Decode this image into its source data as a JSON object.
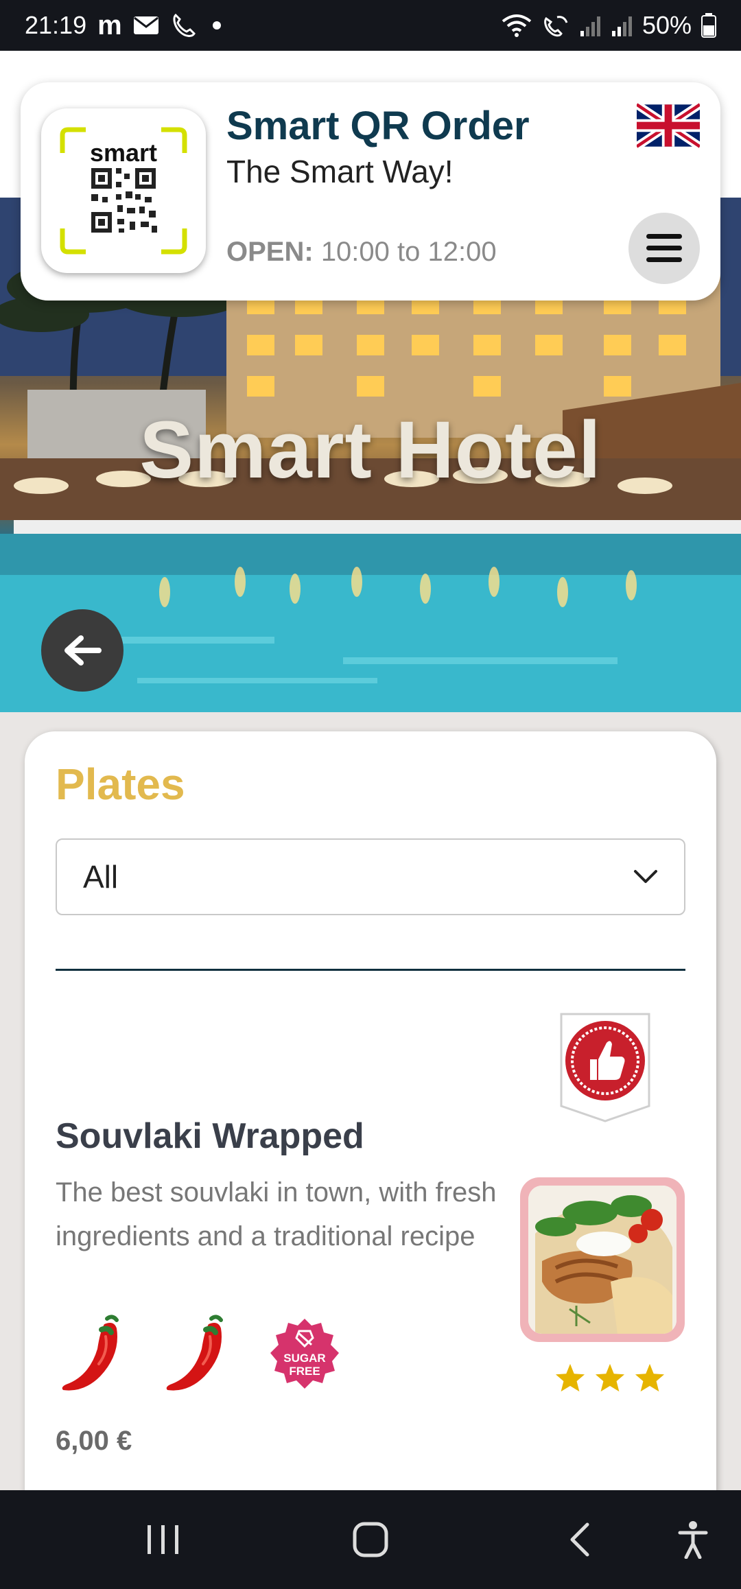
{
  "status_bar": {
    "time": "21:19",
    "carrier_glyph": "m",
    "battery": "50%"
  },
  "header": {
    "logo_text": "smart",
    "title": "Smart QR Order",
    "subtitle": "The Smart Way!",
    "open_label": "OPEN:",
    "open_hours": "10:00 to 12:00",
    "language_flag": "uk-flag-icon"
  },
  "hero": {
    "title": "Smart Hotel"
  },
  "section": {
    "title": "Plates",
    "filter_value": "All"
  },
  "item": {
    "name": "Souvlaki Wrapped",
    "description": "The best souvlaki in town, with fresh ingredients and a traditional recipe",
    "sugar_free_label_1": "SUGAR",
    "sugar_free_label_2": "FREE",
    "rating_stars": 3,
    "price": "6,00 €"
  },
  "colors": {
    "brand_dark": "#0f3a4f",
    "section_gold": "#e2b94e",
    "badge_red": "#c8202c",
    "chili_red": "#d41414",
    "star_yellow": "#e6b400",
    "sugar_free_pink": "#d6336c"
  }
}
